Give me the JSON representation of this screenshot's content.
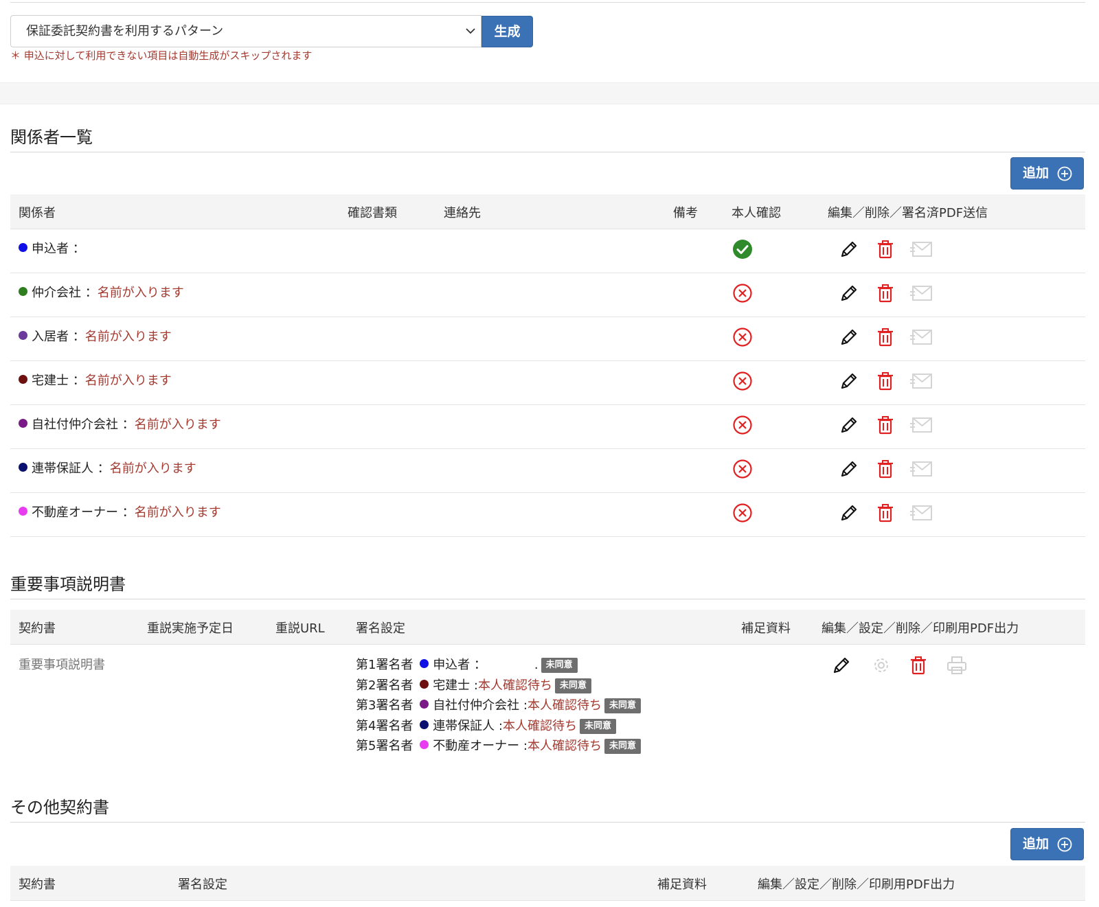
{
  "pattern": {
    "selected": "保証委託契約書を利用するパターン",
    "generate_label": "生成",
    "note": "＊ 申込に対して利用できない項目は自動生成がスキップされます"
  },
  "parties": {
    "title": "関係者一覧",
    "add_label": "追加",
    "headers": [
      "関係者",
      "確認書類",
      "連絡先",
      "備考",
      "本人確認",
      "編集／削除／署名済PDF送信"
    ],
    "rows": [
      {
        "role": "申込者",
        "sep": "：",
        "name": "",
        "color": "#1010e6",
        "verified": true
      },
      {
        "role": "仲介会社",
        "sep": "：",
        "name": "名前が入ります",
        "color": "#2e7d1e",
        "verified": false
      },
      {
        "role": "入居者",
        "sep": "：",
        "name": "名前が入ります",
        "color": "#6a3a9c",
        "verified": false
      },
      {
        "role": "宅建士",
        "sep": "：",
        "name": "名前が入ります",
        "color": "#6e1010",
        "verified": false
      },
      {
        "role": "自社付仲介会社",
        "sep": "：",
        "name": "名前が入ります",
        "color": "#7a1a86",
        "verified": false
      },
      {
        "role": "連帯保証人",
        "sep": "：",
        "name": "名前が入ります",
        "color": "#0a1070",
        "verified": false
      },
      {
        "role": "不動産オーナー",
        "sep": "：",
        "name": "名前が入ります",
        "color": "#e83cf0",
        "verified": false
      }
    ]
  },
  "important": {
    "title": "重要事項説明書",
    "headers": [
      "契約書",
      "重説実施予定日",
      "重説URL",
      "署名設定",
      "補足資料",
      "編集／設定／削除／印刷用PDF出力"
    ],
    "doc_name": "重要事項説明書",
    "signers": [
      {
        "order": "第1署名者",
        "role": "申込者",
        "sep": "：",
        "status": "",
        "tail": ".",
        "color": "#1010e6",
        "badge": "未同意"
      },
      {
        "order": "第2署名者",
        "role": "宅建士",
        "sep": ":",
        "status": "本人確認待ち",
        "tail": "",
        "color": "#6e1010",
        "badge": "未同意"
      },
      {
        "order": "第3署名者",
        "role": "自社付仲介会社",
        "sep": ":",
        "status": "本人確認待ち",
        "tail": "",
        "color": "#7a1a86",
        "badge": "未同意"
      },
      {
        "order": "第4署名者",
        "role": "連帯保証人",
        "sep": ":",
        "status": "本人確認待ち",
        "tail": "",
        "color": "#0a1070",
        "badge": "未同意"
      },
      {
        "order": "第5署名者",
        "role": "不動産オーナー",
        "sep": ":",
        "status": "本人確認待ち",
        "tail": "",
        "color": "#e83cf0",
        "badge": "未同意"
      }
    ]
  },
  "other": {
    "title": "その他契約書",
    "add_label": "追加",
    "headers": [
      "契約書",
      "署名設定",
      "補足資料",
      "編集／設定／削除／印刷用PDF出力"
    ]
  }
}
